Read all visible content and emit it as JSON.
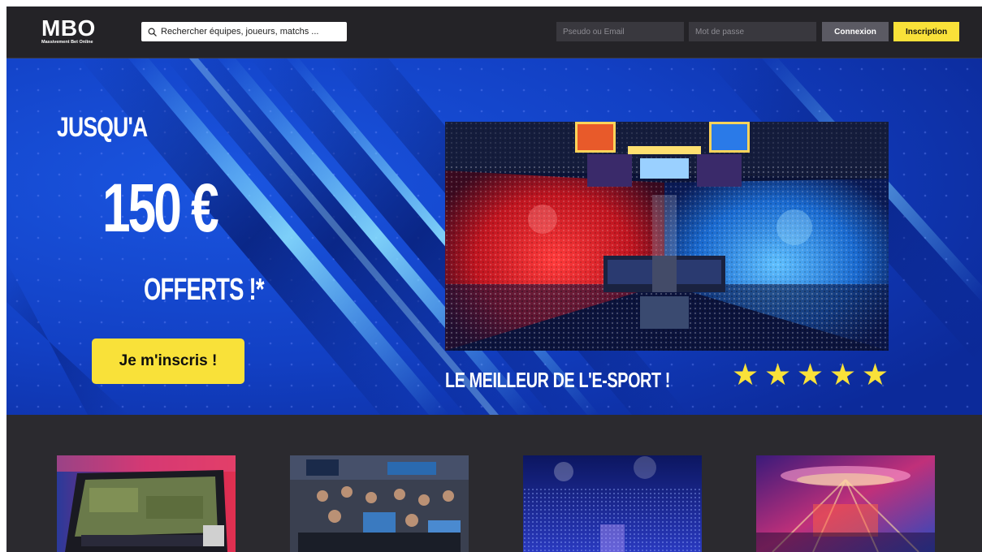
{
  "header": {
    "logo_title": "MBO",
    "logo_subtitle": "Massivement Bet Online",
    "search_placeholder": "Rechercher équipes, joueurs, matchs ...",
    "username_placeholder": "Pseudo ou Email",
    "password_placeholder": "Mot de passe",
    "login_label": "Connexion",
    "signup_label": "Inscription"
  },
  "hero": {
    "line1": "JUSQU'A",
    "amount": "150 €",
    "line3": "OFFERTS !*",
    "cta_label": "Je m'inscris !",
    "tagline": "LE MEILLEUR DE L'E-SPORT !",
    "stars": [
      "★",
      "★",
      "★",
      "★",
      "★"
    ]
  },
  "colors": {
    "accent_yellow": "#f9e139",
    "hero_blue": "#1240c4",
    "header_dark": "#242327",
    "page_dark": "#2b2a2f"
  },
  "icons": {
    "search": "search-icon",
    "star": "star-icon"
  }
}
